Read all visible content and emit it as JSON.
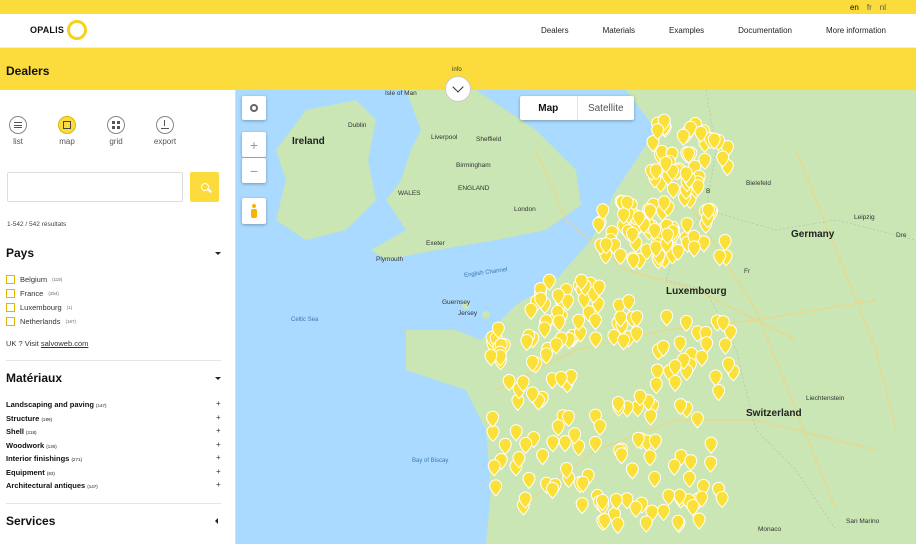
{
  "languages": [
    "en",
    "fr",
    "nl"
  ],
  "active_language": "en",
  "brand": {
    "name": "OPALIS"
  },
  "nav": [
    "Dealers",
    "Materials",
    "Examples",
    "Documentation",
    "More information"
  ],
  "page": {
    "title": "Dealers",
    "info_label": "info"
  },
  "views": [
    {
      "label": "list",
      "icon": "list-icon"
    },
    {
      "label": "map",
      "icon": "map-icon",
      "active": true
    },
    {
      "label": "grid",
      "icon": "grid-icon"
    },
    {
      "label": "export",
      "icon": "export-icon"
    }
  ],
  "search": {
    "value": "",
    "placeholder": ""
  },
  "results": "1-542 / 542 résultats",
  "pays": {
    "title": "Pays",
    "items": [
      {
        "label": "Belgium",
        "count": "(119)"
      },
      {
        "label": "France",
        "count": "(254)"
      },
      {
        "label": "Luxembourg",
        "count": "(1)"
      },
      {
        "label": "Netherlands",
        "count": "(167)"
      }
    ],
    "uk_prefix": "UK ? Visit ",
    "uk_link": "salvoweb.com"
  },
  "materiaux": {
    "title": "Matériaux",
    "items": [
      {
        "label": "Landscaping and paving",
        "count": "(147)"
      },
      {
        "label": "Structure",
        "count": "(189)"
      },
      {
        "label": "Shell",
        "count": "(218)"
      },
      {
        "label": "Woodwork",
        "count": "(130)"
      },
      {
        "label": "Interior finishings",
        "count": "(271)"
      },
      {
        "label": "Equipment",
        "count": "(83)"
      },
      {
        "label": "Architectural antiques",
        "count": "(147)"
      }
    ]
  },
  "services": {
    "title": "Services"
  },
  "map": {
    "toggle": [
      "Map",
      "Satellite"
    ],
    "active": "Map",
    "labels": {
      "isle_of_man": "Isle of Man",
      "ireland": "Ireland",
      "dublin": "Dublin",
      "liverpool": "Liverpool",
      "sheffield": "Sheffield",
      "birmingham": "Birmingham",
      "wales": "WALES",
      "england": "ENGLAND",
      "london": "London",
      "exeter": "Exeter",
      "plymouth": "Plymouth",
      "english_channel": "English Channel",
      "guernsey": "Guernsey",
      "jersey": "Jersey",
      "celtic_sea": "Celtic Sea",
      "bay_of_biscay": "Bay of Biscay",
      "germany": "Germany",
      "bielefeld": "Bielefeld",
      "leipzig": "Leipzig",
      "luxembourg": "Luxembourg",
      "switzerland": "Switzerland",
      "liechtenstein": "Liechtenstein",
      "san_marino": "San Marino",
      "monaco": "Monaco",
      "dresden": "Dre",
      "frankfurt": "Fr",
      "bruxelles": "B"
    }
  },
  "colors": {
    "brand_yellow": "#fbdc3c",
    "marker_yellow": "#fbe039",
    "water": "#aadaff",
    "land": "#c9e6b4"
  }
}
